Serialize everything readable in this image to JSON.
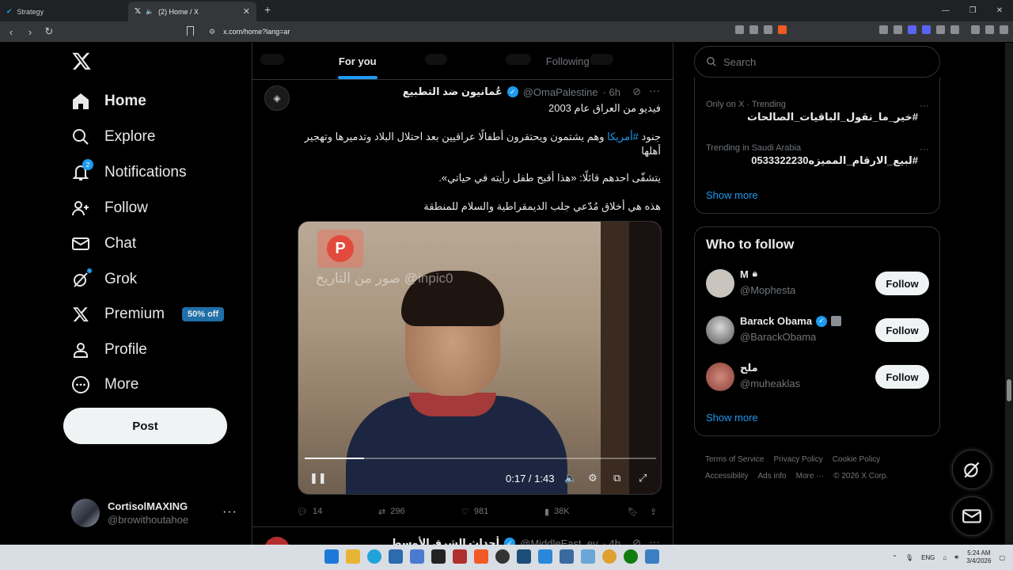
{
  "browser": {
    "tabs": [
      {
        "title": "Strategy"
      },
      {
        "title": "(2) Home / X"
      }
    ],
    "url": "x.com/home?lang=ar"
  },
  "nav": {
    "items": [
      {
        "label": "Home"
      },
      {
        "label": "Explore"
      },
      {
        "label": "Notifications",
        "badge": "2"
      },
      {
        "label": "Follow"
      },
      {
        "label": "Chat"
      },
      {
        "label": "Grok"
      },
      {
        "label": "Premium",
        "badge": "50% off"
      },
      {
        "label": "Profile"
      },
      {
        "label": "More"
      }
    ],
    "post_label": "Post",
    "account": {
      "name": "CortisolMAXING",
      "handle": "@browithoutahoe"
    }
  },
  "feed": {
    "tabs": [
      "For you",
      "Following"
    ],
    "tweet": {
      "name": "عُمانيون ضد التطبيع",
      "handle": "@OmaPalestine",
      "time": "· 6h",
      "line1": "فيديو من العراق  عام 2003",
      "line2_pre": "جنود ",
      "line2_tag": "#أمريكا",
      "line2_post": " وهم يشتمون ويحتقرون أطفالًا عراقيين بعد احتلال البلاد وتدميرها وتهجير أهلها",
      "line3": "يتشفّى احدهم قائلًا: «هذا أقبح طفل رأيته في حياتي».",
      "line4": "هذه هي أخلاق مُدّعي جلب الديمقراطية والسلام للمنطقة",
      "video": {
        "watermark": "صور من التاريخ @inpic0",
        "logo_letter": "P",
        "time": "0:17 / 1:43",
        "progress": 0.17
      },
      "stats": {
        "replies": "14",
        "reposts": "296",
        "likes": "981",
        "views": "38K"
      }
    },
    "next_tweet": {
      "name": "أحداث الشرق الأوسط",
      "handle": "@MiddleEast_ev",
      "time": "· 4h"
    }
  },
  "sidebar": {
    "search_placeholder": "Search",
    "trends": [
      {
        "context": "Only on X · Trending",
        "tag": "#خير_ما_نقول_الباقيات_الصالحات"
      },
      {
        "context": "Trending in Saudi Arabia",
        "tag": "#لبيع_الارقام_المميزه0533322230"
      }
    ],
    "show_more": "Show more",
    "wtf_title": "Who to follow",
    "who_to_follow": [
      {
        "name": "M",
        "handle": "@Mophesta",
        "button": "Follow",
        "lock": true,
        "color": "#c9c4be"
      },
      {
        "name": "Barack Obama",
        "handle": "@BarackObama",
        "button": "Follow",
        "verified": true,
        "color": "#7f7f7f"
      },
      {
        "name": "ملح",
        "handle": "@muheaklas",
        "button": "Follow",
        "color": "#b36a5e"
      }
    ],
    "footer": [
      "Terms of Service",
      "Privacy Policy",
      "Cookie Policy",
      "Accessibility",
      "Ads info",
      "More ···",
      "© 2026 X Corp."
    ]
  },
  "taskbar": {
    "lang": "ENG",
    "time": "5:24 AM",
    "date": "3/4/2026"
  }
}
